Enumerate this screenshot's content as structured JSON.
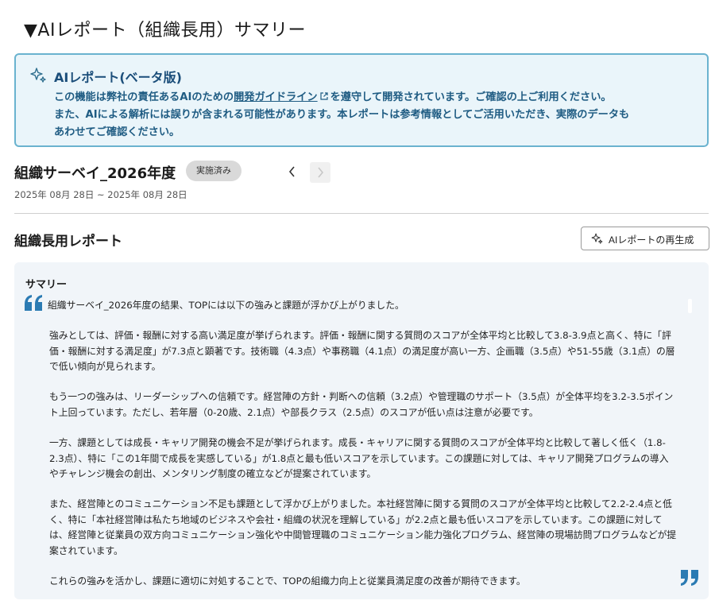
{
  "section": {
    "title": "▼AIレポート（組織長用）サマリー"
  },
  "notice": {
    "title": "AIレポート(ベータ版)",
    "line1_pre": "この機能は弊社の責任あるAIのための",
    "line1_link": "開発ガイドライン",
    "line1_post": "を遵守して開発されています。ご確認の上ご利用ください。",
    "line2": "また、AIによる解析には誤りが含まれる可能性があります。本レポートは参考情報としてご活用いただき、実際のデータも",
    "line3": "あわせてご確認ください。"
  },
  "survey": {
    "name": "組織サーベイ_2026年度",
    "status": "実施済み",
    "date_range": "2025年 08月 28日 ~ 2025年 08月 28日"
  },
  "report": {
    "title": "組織長用レポート",
    "regenerate_label": "AIレポートの再生成"
  },
  "summary": {
    "title": "サマリー",
    "lead": "組織サーベイ_2026年度の結果、TOPには以下の強みと課題が浮かび上がりました。",
    "paragraphs": [
      "強みとしては、評価・報酬に対する高い満足度が挙げられます。評価・報酬に関する質問のスコアが全体平均と比較して3.8-3.9点と高く、特に「評価・報酬に対する満足度」が7.3点と顕著です。技術職（4.3点）や事務職（4.1点）の満足度が高い一方、企画職（3.5点）や51-55歳（3.1点）の層で低い傾向が見られます。",
      "もう一つの強みは、リーダーシップへの信頼です。経営陣の方針・判断への信頼（3.2点）や管理職のサポート（3.5点）が全体平均を3.2-3.5ポイント上回っています。ただし、若年層（0-20歳、2.1点）や部長クラス（2.5点）のスコアが低い点は注意が必要です。",
      "一方、課題としては成長・キャリア開発の機会不足が挙げられます。成長・キャリアに関する質問のスコアが全体平均と比較して著しく低く（1.8-2.3点）、特に「この1年間で成長を実感している」が1.8点と最も低いスコアを示しています。この課題に対しては、キャリア開発プログラムの導入やチャレンジ機会の創出、メンタリング制度の確立などが提案されています。",
      "また、経営陣とのコミュニケーション不足も課題として浮かび上がりました。本社経営陣に関する質問のスコアが全体平均と比較して2.2-2.4点と低く、特に「本社経営陣は私たち地域のビジネスや会社・組織の状況を理解している」が2.2点と最も低いスコアを示しています。この課題に対しては、経営陣と従業員の双方向コミュニケーション強化や中間管理職のコミュニケーション能力強化プログラム、経営陣の現場訪問プログラムなどが提案されています。",
      "これらの強みを活かし、課題に適切に対処することで、TOPの組織力向上と従業員満足度の改善が期待できます。"
    ]
  },
  "icons": {
    "notice": "sparkle-icon",
    "external": "external-link-icon",
    "prev": "chevron-left-icon",
    "next": "chevron-right-icon",
    "regenerate": "sparkle-icon",
    "quote_open": "quote-open-icon",
    "quote_close": "quote-close-icon"
  },
  "colors": {
    "notice_bg": "#eaf5fa",
    "notice_border": "#6ab3cf",
    "notice_text": "#1f5c83",
    "quote_accent": "#2b7bb3",
    "summary_bg": "#f1f5f9"
  }
}
